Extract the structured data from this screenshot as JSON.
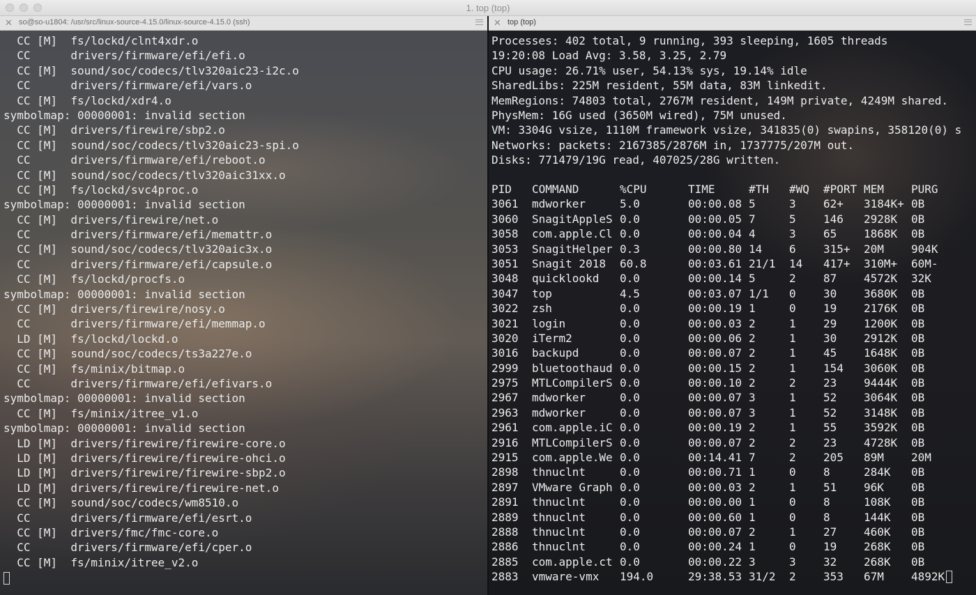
{
  "window": {
    "title": "1. top (top)"
  },
  "left_tab": {
    "title": "so@so-u1804: /usr/src/linux-source-4.15.0/linux-source-4.15.0 (ssh)"
  },
  "right_tab": {
    "title": "top (top)"
  },
  "left_lines": [
    "  CC [M]  fs/lockd/clnt4xdr.o",
    "  CC      drivers/firmware/efi/efi.o",
    "  CC [M]  sound/soc/codecs/tlv320aic23-i2c.o",
    "  CC      drivers/firmware/efi/vars.o",
    "  CC [M]  fs/lockd/xdr4.o",
    "symbolmap: 00000001: invalid section",
    "  CC [M]  drivers/firewire/sbp2.o",
    "  CC [M]  sound/soc/codecs/tlv320aic23-spi.o",
    "  CC      drivers/firmware/efi/reboot.o",
    "  CC [M]  sound/soc/codecs/tlv320aic31xx.o",
    "  CC [M]  fs/lockd/svc4proc.o",
    "symbolmap: 00000001: invalid section",
    "  CC [M]  drivers/firewire/net.o",
    "  CC      drivers/firmware/efi/memattr.o",
    "  CC [M]  sound/soc/codecs/tlv320aic3x.o",
    "  CC      drivers/firmware/efi/capsule.o",
    "  CC [M]  fs/lockd/procfs.o",
    "symbolmap: 00000001: invalid section",
    "  CC [M]  drivers/firewire/nosy.o",
    "  CC      drivers/firmware/efi/memmap.o",
    "  LD [M]  fs/lockd/lockd.o",
    "  CC [M]  sound/soc/codecs/ts3a227e.o",
    "  CC [M]  fs/minix/bitmap.o",
    "  CC      drivers/firmware/efi/efivars.o",
    "symbolmap: 00000001: invalid section",
    "  CC [M]  fs/minix/itree_v1.o",
    "symbolmap: 00000001: invalid section",
    "  LD [M]  drivers/firewire/firewire-core.o",
    "  LD [M]  drivers/firewire/firewire-ohci.o",
    "  LD [M]  drivers/firewire/firewire-sbp2.o",
    "  LD [M]  drivers/firewire/firewire-net.o",
    "  CC [M]  sound/soc/codecs/wm8510.o",
    "  CC      drivers/firmware/efi/esrt.o",
    "  CC [M]  drivers/fmc/fmc-core.o",
    "  CC      drivers/firmware/efi/cper.o",
    "  CC [M]  fs/minix/itree_v2.o"
  ],
  "top_summary": [
    "Processes: 402 total, 9 running, 393 sleeping, 1605 threads",
    "19:20:08 Load Avg: 3.58, 3.25, 2.79",
    "CPU usage: 26.71% user, 54.13% sys, 19.14% idle",
    "SharedLibs: 225M resident, 55M data, 83M linkedit.",
    "MemRegions: 74803 total, 2767M resident, 149M private, 4249M shared.",
    "PhysMem: 16G used (3650M wired), 75M unused.",
    "VM: 3304G vsize, 1110M framework vsize, 341835(0) swapins, 358120(0) s",
    "Networks: packets: 2167385/2876M in, 1737775/207M out.",
    "Disks: 771479/19G read, 407025/28G written."
  ],
  "process_table": {
    "headers": [
      "PID",
      "COMMAND",
      "%CPU",
      "TIME",
      "#TH",
      "#WQ",
      "#PORT",
      "MEM",
      "PURG"
    ],
    "rows": [
      [
        "3061",
        "mdworker",
        "5.0",
        "00:00.08",
        "5",
        "3",
        "62+",
        "3184K+",
        "0B"
      ],
      [
        "3060",
        "SnagitAppleS",
        "0.0",
        "00:00.05",
        "7",
        "5",
        "146",
        "2928K",
        "0B"
      ],
      [
        "3058",
        "com.apple.Cl",
        "0.0",
        "00:00.04",
        "4",
        "3",
        "65",
        "1868K",
        "0B"
      ],
      [
        "3053",
        "SnagitHelper",
        "0.3",
        "00:00.80",
        "14",
        "6",
        "315+",
        "20M",
        "904K"
      ],
      [
        "3051",
        "Snagit 2018",
        "60.8",
        "00:03.61",
        "21/1",
        "14",
        "417+",
        "310M+",
        "60M-"
      ],
      [
        "3048",
        "quicklookd",
        "0.0",
        "00:00.14",
        "5",
        "2",
        "87",
        "4572K",
        "32K"
      ],
      [
        "3047",
        "top",
        "4.5",
        "00:03.07",
        "1/1",
        "0",
        "30",
        "3680K",
        "0B"
      ],
      [
        "3022",
        "zsh",
        "0.0",
        "00:00.19",
        "1",
        "0",
        "19",
        "2176K",
        "0B"
      ],
      [
        "3021",
        "login",
        "0.0",
        "00:00.03",
        "2",
        "1",
        "29",
        "1200K",
        "0B"
      ],
      [
        "3020",
        "iTerm2",
        "0.0",
        "00:00.06",
        "2",
        "1",
        "30",
        "2912K",
        "0B"
      ],
      [
        "3016",
        "backupd",
        "0.0",
        "00:00.07",
        "2",
        "1",
        "45",
        "1648K",
        "0B"
      ],
      [
        "2999",
        "bluetoothaud",
        "0.0",
        "00:00.15",
        "2",
        "1",
        "154",
        "3060K",
        "0B"
      ],
      [
        "2975",
        "MTLCompilerS",
        "0.0",
        "00:00.10",
        "2",
        "2",
        "23",
        "9444K",
        "0B"
      ],
      [
        "2967",
        "mdworker",
        "0.0",
        "00:00.07",
        "3",
        "1",
        "52",
        "3064K",
        "0B"
      ],
      [
        "2963",
        "mdworker",
        "0.0",
        "00:00.07",
        "3",
        "1",
        "52",
        "3148K",
        "0B"
      ],
      [
        "2961",
        "com.apple.iC",
        "0.0",
        "00:00.19",
        "2",
        "1",
        "55",
        "3592K",
        "0B"
      ],
      [
        "2916",
        "MTLCompilerS",
        "0.0",
        "00:00.07",
        "2",
        "2",
        "23",
        "4728K",
        "0B"
      ],
      [
        "2915",
        "com.apple.We",
        "0.0",
        "00:14.41",
        "7",
        "2",
        "205",
        "89M",
        "20M"
      ],
      [
        "2898",
        "thnuclnt",
        "0.0",
        "00:00.71",
        "1",
        "0",
        "8",
        "284K",
        "0B"
      ],
      [
        "2897",
        "VMware Graph",
        "0.0",
        "00:00.03",
        "2",
        "1",
        "51",
        "96K",
        "0B"
      ],
      [
        "2891",
        "thnuclnt",
        "0.0",
        "00:00.00",
        "1",
        "0",
        "8",
        "108K",
        "0B"
      ],
      [
        "2889",
        "thnuclnt",
        "0.0",
        "00:00.60",
        "1",
        "0",
        "8",
        "144K",
        "0B"
      ],
      [
        "2888",
        "thnuclnt",
        "0.0",
        "00:00.07",
        "2",
        "1",
        "27",
        "460K",
        "0B"
      ],
      [
        "2886",
        "thnuclnt",
        "0.0",
        "00:00.24",
        "1",
        "0",
        "19",
        "268K",
        "0B"
      ],
      [
        "2885",
        "com.apple.ct",
        "0.0",
        "00:00.22",
        "3",
        "3",
        "32",
        "268K",
        "0B"
      ],
      [
        "2883",
        "vmware-vmx",
        "194.0",
        "29:38.53",
        "31/2",
        "2",
        "353",
        "67M",
        "4892K"
      ]
    ]
  }
}
